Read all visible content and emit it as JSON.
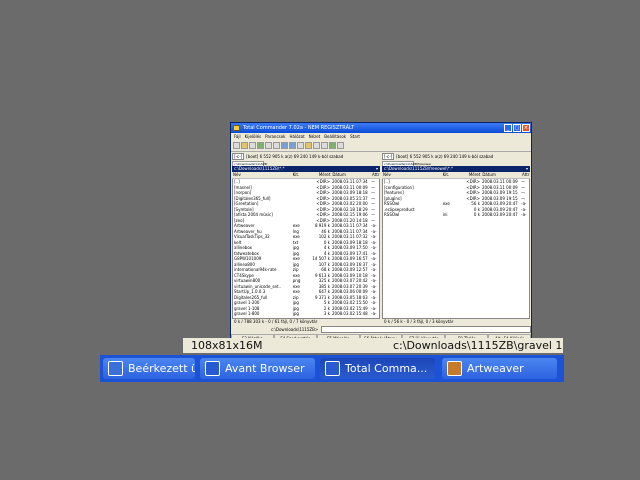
{
  "window": {
    "title": "Total Commander 7.02a - NEM REGISZTRÁLT",
    "min": "_",
    "max": "□",
    "close": "×"
  },
  "menu": [
    "Fájl",
    "Kijelölés",
    "Parancsok",
    "Hálózat",
    "Nézet",
    "Beállítások",
    "Start"
  ],
  "left_panel": {
    "drive": "[-c-]",
    "drive_info": "[boot]  6 552 905 k a(z) 69 240 149 k-ból szabad",
    "tab": "c:\\Downloads\\1115ZB",
    "path": "c:\\Downloads\\1115ZB\\*.*",
    "columns": [
      "Név",
      "Kit.",
      "Méret",
      "Dátum",
      "Attr"
    ],
    "files": [
      [
        "[..]",
        "",
        "<DIR>",
        "2008.03.11 07:34",
        "—"
      ],
      [
        "[masnel]",
        "",
        "<DIR>",
        "2008.03.11 00:09",
        "—"
      ],
      [
        "[norpon]",
        "",
        "<DIR>",
        "2008.03.09 18:18",
        "—"
      ],
      [
        "[Digitales365_full]",
        "",
        "<DIR>",
        "2008.03.05 21:37",
        "—"
      ],
      [
        "[Greetation]",
        "",
        "<DIR>",
        "2008.03.02 20:00",
        "—"
      ],
      [
        "[Symtole]",
        "",
        "<DIR>",
        "2008.02.18 18:29",
        "—"
      ],
      [
        "[afísta 2004 mûsic]",
        "",
        "<DIR>",
        "2008.02.15 19:06",
        "—"
      ],
      [
        "[zeo]",
        "",
        "<DIR>",
        "2008.01.20 14:18",
        "—"
      ],
      [
        "Artweaver",
        "exe",
        "8 919 k",
        "2008.03.11 07:34",
        "-a-"
      ],
      [
        "Artweaver_hu",
        "lng",
        "46 k",
        "2008.03.11 07:34",
        "-a-"
      ],
      [
        "VisualTaskTips_32",
        "exe",
        "102 k",
        "2008.03.11 07:32",
        "-a-"
      ],
      [
        "kelt",
        "txt",
        "0 k",
        "2008.03.09 18:18",
        "-a-"
      ],
      [
        "allinebox",
        "jpg",
        "4 k",
        "2008.03.09 17:50",
        "-a-"
      ],
      [
        "fatweatebox",
        "jpg",
        "4 k",
        "2008.03.09 17:41",
        "-a-"
      ],
      [
        "G8PW101009",
        "exe",
        "14 507 k",
        "2008.03.09 16:57",
        "-a-"
      ],
      [
        "allinea800",
        "jpg",
        "107 k",
        "2008.03.09 16:37",
        "-a-"
      ],
      [
        "international94k-rate",
        "zip",
        "68 k",
        "2008.03.09 12:57",
        "-a-"
      ],
      [
        "CT4Skype",
        "exe",
        "9 613 k",
        "2008.03.09 10:18",
        "-a-"
      ],
      [
        "virtuawin800",
        "png",
        "325 k",
        "2008.03.07 20:42",
        "-a-"
      ],
      [
        "virtuawin_unicode_set..",
        "exe",
        "385 k",
        "2008.03.07 20:39",
        "-a-"
      ],
      [
        "StartUp_1.0.0.3",
        "exe",
        "647 k",
        "2008.03.06 00:09",
        "-a-"
      ],
      [
        "Digitales265_full",
        "zip",
        "9 371 k",
        "2008.03.05 18:03",
        "-a-"
      ],
      [
        "gravel 1-200",
        "jpg",
        "5 k",
        "2008.03.02 15:50",
        "-a-"
      ],
      [
        "gravel 1-108",
        "jpg",
        "2 k",
        "2008.03.02 15:49",
        "-a-"
      ],
      [
        "gravel 1-800",
        "jpg",
        "3 k",
        "2008.03.02 15:48",
        "-a-"
      ]
    ],
    "status": "0 k / 788 303 k - 0 / 61 fájl, 0 / 7 könyvtár"
  },
  "right_panel": {
    "drive": "[-c-]",
    "drive_info": "[boot]  6 552 905 k a(z) 69 240 149 k-ból szabad",
    "tab": "c:\\Downloads\\1115ZB\\freeowel",
    "path": "c:\\Downloads\\1115ZB\\freeowel\\*.*",
    "columns": [
      "Név",
      "Kit.",
      "Méret",
      "Dátum",
      "Attr"
    ],
    "files": [
      [
        "[..]",
        "",
        "<DIR>",
        "2008.03.11 00:09",
        "—"
      ],
      [
        "[configuration]",
        "",
        "<DIR>",
        "2008.03.11 00:09",
        "—"
      ],
      [
        "[features]",
        "",
        "<DIR>",
        "2008.03.09 19:15",
        "—"
      ],
      [
        "[plugins]",
        "",
        "<DIR>",
        "2008.03.09 19:15",
        "—"
      ],
      [
        "RSSOwl",
        "exe",
        "56 k",
        "2008.03.09 20:47",
        "-a-"
      ],
      [
        ".eclipseproduct",
        "",
        "0 k",
        "2008.03.09 20:47",
        "-a-"
      ],
      [
        "RSSOwl",
        "ini",
        "0 k",
        "2008.03.09 20:47",
        "-a-"
      ]
    ],
    "status": "0 k / 56 k - 0 / 3 fájl, 0 / 3 könyvtár"
  },
  "cmdline": {
    "prompt": "c:\\Downloads\\1115ZB>"
  },
  "fkeys": [
    "F3 Nézőke",
    "F4 Szerkesztés",
    "F5 Másolás",
    "F6 Áthely./Átnev.",
    "F7 Új könyvtár",
    "F8 Törlés",
    "Alt+F4 Kilépés"
  ],
  "tooltip": {
    "left": "108x81x16M",
    "right": "c:\\Downloads\\1115ZB\\gravel 1-108.jpg"
  },
  "taskbar": {
    "tasks": [
      {
        "label": "Beérkezett ü...",
        "icon": "email-icon",
        "color": "#3b6fd9"
      },
      {
        "label": "Avant Browser",
        "icon": "avant-browser-icon",
        "color": "#2a5ad0"
      },
      {
        "label": "Total Comma...",
        "icon": "floppy-disk-icon",
        "color": "#2a5ad0"
      },
      {
        "label": "Artweaver",
        "icon": "artweaver-icon",
        "color": "#c77a2a"
      }
    ]
  }
}
